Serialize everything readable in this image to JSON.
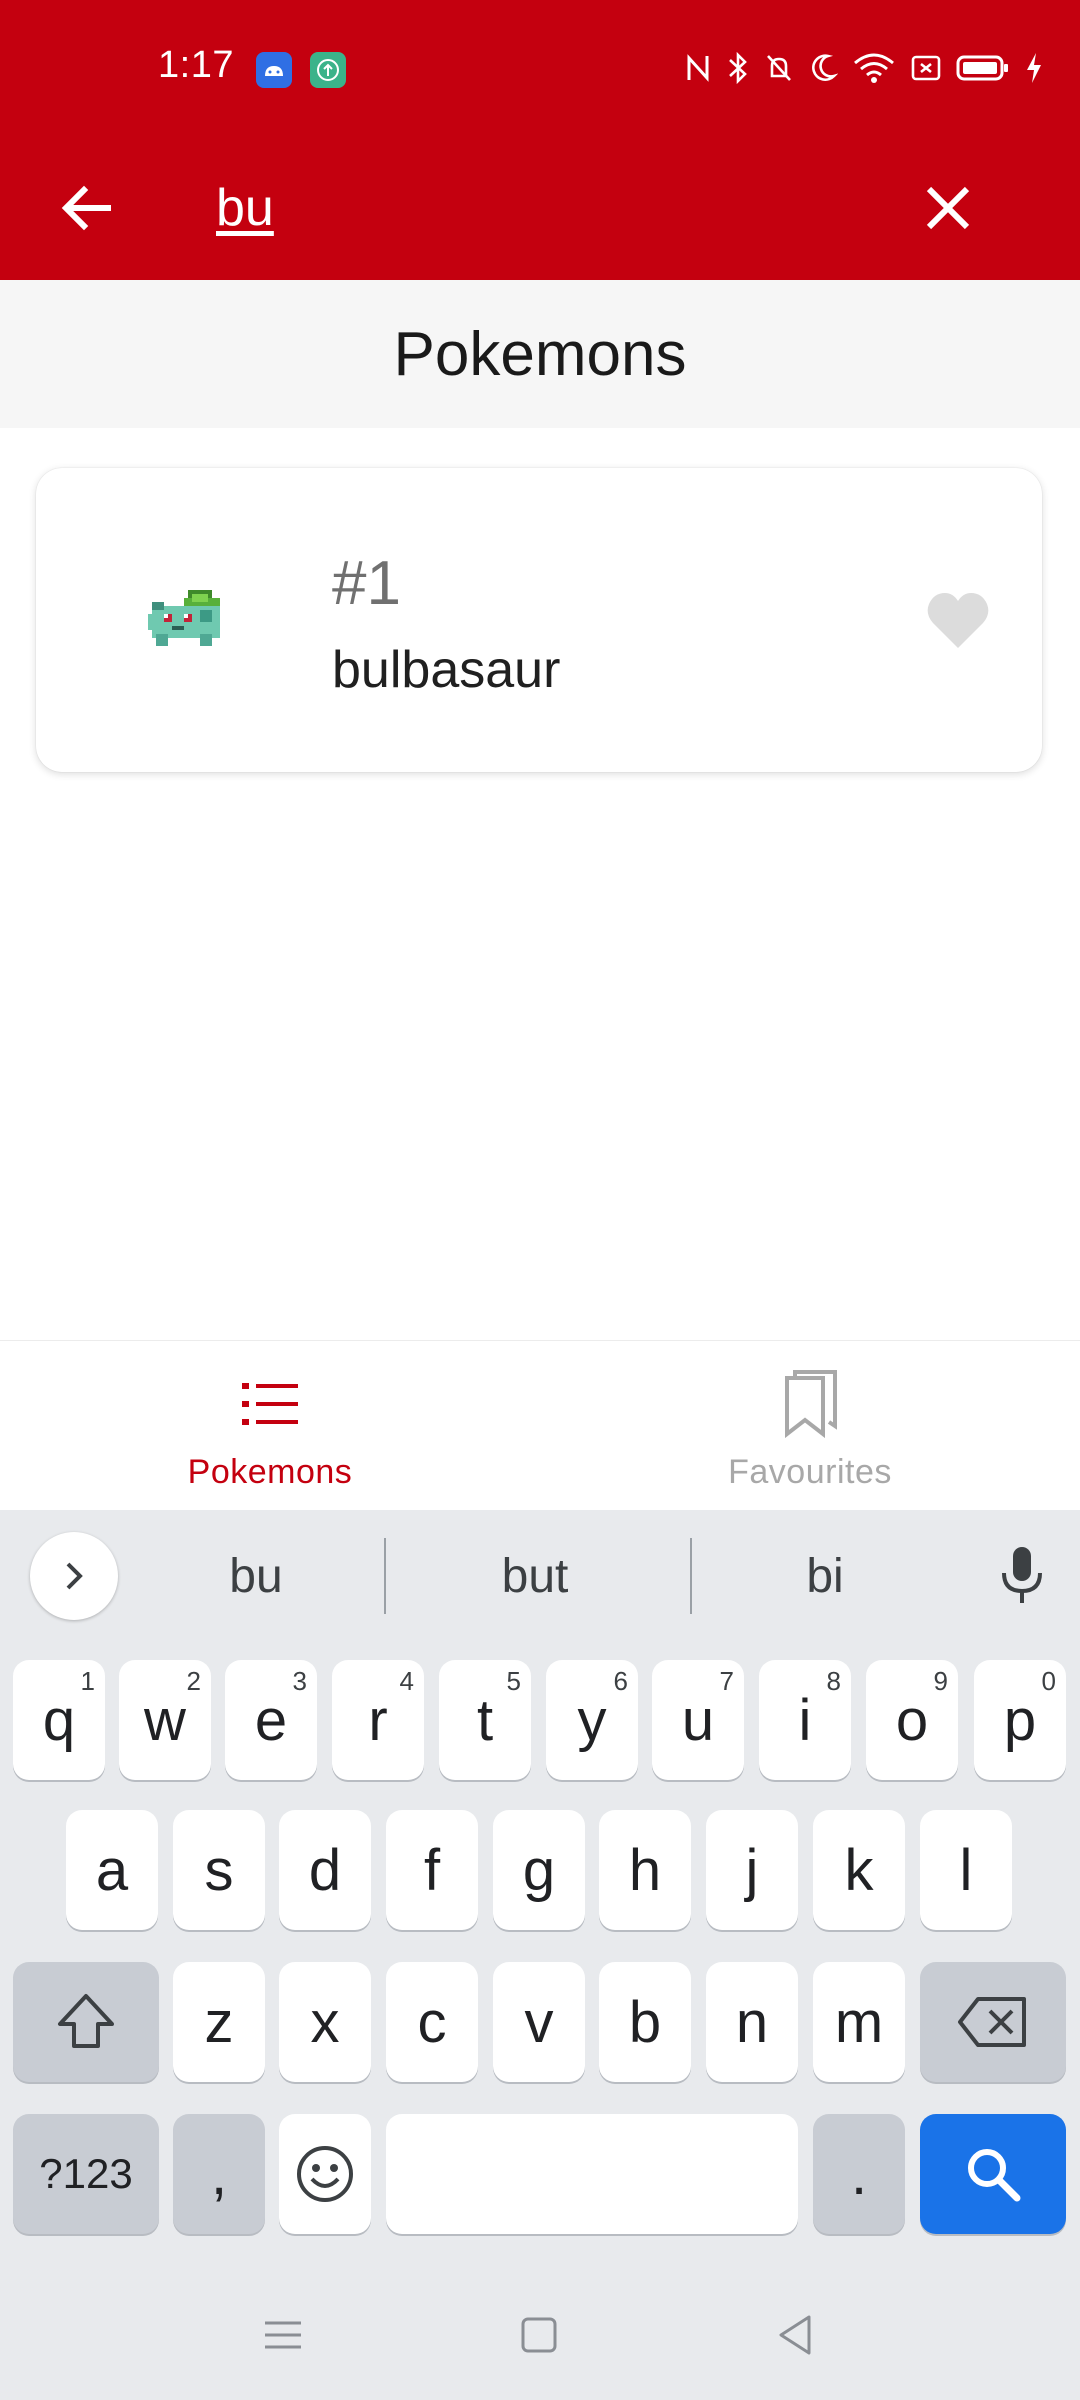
{
  "status_bar": {
    "time": "1:17"
  },
  "app_bar": {
    "search_value": "bu",
    "back_icon": "arrow-left-icon",
    "clear_icon": "close-icon"
  },
  "section": {
    "title": "Pokemons"
  },
  "pokemon_list": [
    {
      "number": "#1",
      "name": "bulbasaur",
      "favourite": false
    }
  ],
  "bottom_nav": {
    "items": [
      {
        "label": "Pokemons",
        "icon": "list-icon",
        "active": true
      },
      {
        "label": "Favourites",
        "icon": "bookmark-icon",
        "active": false
      }
    ]
  },
  "keyboard": {
    "suggestions": [
      "bu",
      "but",
      "bi"
    ],
    "row1": [
      {
        "key": "q",
        "hint": "1"
      },
      {
        "key": "w",
        "hint": "2"
      },
      {
        "key": "e",
        "hint": "3"
      },
      {
        "key": "r",
        "hint": "4"
      },
      {
        "key": "t",
        "hint": "5"
      },
      {
        "key": "y",
        "hint": "6"
      },
      {
        "key": "u",
        "hint": "7"
      },
      {
        "key": "i",
        "hint": "8"
      },
      {
        "key": "o",
        "hint": "9"
      },
      {
        "key": "p",
        "hint": "0"
      }
    ],
    "row2": [
      "a",
      "s",
      "d",
      "f",
      "g",
      "h",
      "j",
      "k",
      "l"
    ],
    "row3": [
      "z",
      "x",
      "c",
      "v",
      "b",
      "n",
      "m"
    ],
    "symbols_label": "?123",
    "comma": ",",
    "period": "."
  },
  "colors": {
    "primary": "#c4000f",
    "accent_blue": "#1a73e8",
    "inactive": "#a8a8a8"
  }
}
